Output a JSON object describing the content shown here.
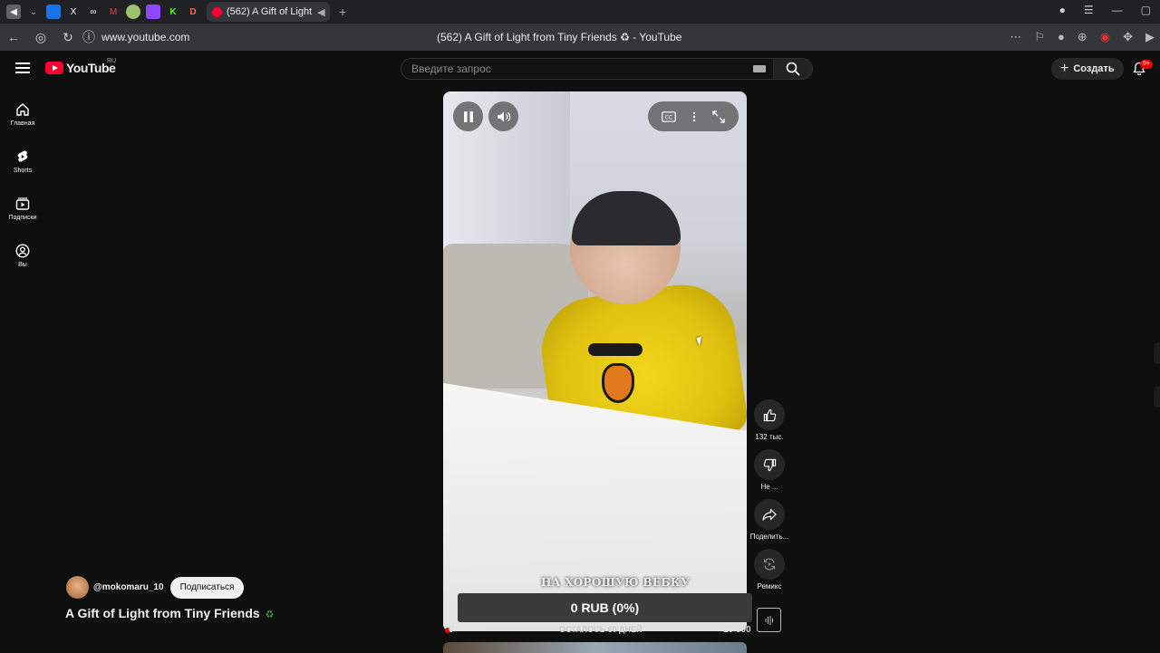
{
  "browser": {
    "tab": {
      "title": "(562) A Gift of Light"
    },
    "url": "www.youtube.com",
    "page_title": "(562) A Gift of Light from Tiny Friends ♻ - YouTube"
  },
  "header": {
    "logo_text": "YouTube",
    "logo_region": "RU",
    "search_placeholder": "Введите запрос",
    "create_label": "Создать",
    "notifications_badge": "9+"
  },
  "sidebar": {
    "items": [
      {
        "label": "Главная",
        "icon": "home-icon"
      },
      {
        "label": "Shorts",
        "icon": "shorts-icon"
      },
      {
        "label": "Подписки",
        "icon": "subscriptions-icon"
      },
      {
        "label": "Вы",
        "icon": "you-icon"
      }
    ]
  },
  "video": {
    "overlay_text": "НА ХОРОШУЮ ВЕБКУ",
    "donation": {
      "amount": "0 RUB (0%)",
      "min": "0",
      "remaining": "ОСТАЛОСЬ 60 ДНЕЙ",
      "max": "10 000"
    }
  },
  "actions": {
    "like_count": "132 тыс.",
    "dislike_label": "Не ...",
    "share_label": "Поделить...",
    "remix_label": "Ремикс"
  },
  "channel": {
    "handle": "@mokomaru_10",
    "subscribe_label": "Подписаться"
  },
  "title": {
    "text": "A Gift of Light from Tiny Friends",
    "emoji": "♻"
  },
  "colors": {
    "brand": "#ff0033",
    "background": "#0f0f0f",
    "donation_bar": "#3a3a3a"
  }
}
